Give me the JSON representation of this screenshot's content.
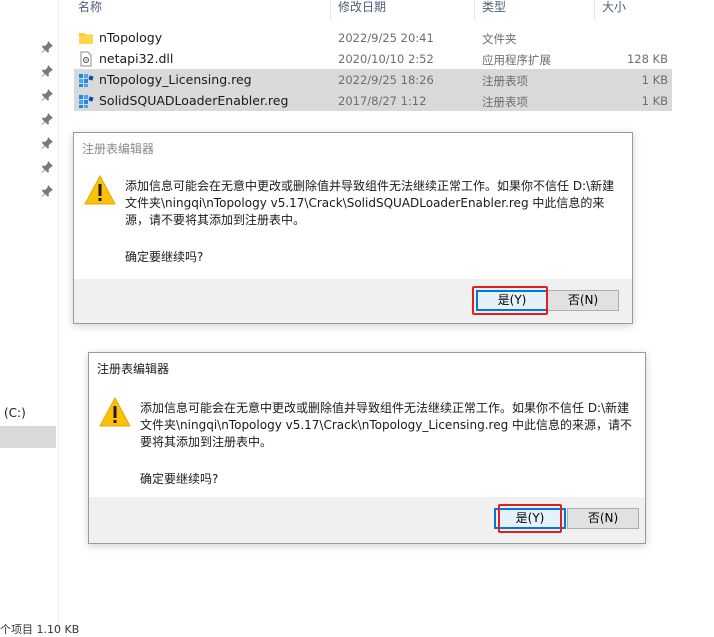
{
  "columns": {
    "name": "名称",
    "date": "修改日期",
    "type": "类型",
    "size": "大小"
  },
  "files": [
    {
      "name": "nTopology",
      "date": "2022/9/25 20:41",
      "type": "文件夹",
      "size": "",
      "icon": "folder-icon",
      "selected": false
    },
    {
      "name": "netapi32.dll",
      "date": "2020/10/10 2:52",
      "type": "应用程序扩展",
      "size": "128 KB",
      "icon": "dll-file-icon",
      "selected": false
    },
    {
      "name": "nTopology_Licensing.reg",
      "date": "2022/9/25 18:26",
      "type": "注册表项",
      "size": "1 KB",
      "icon": "registry-file-icon",
      "selected": true
    },
    {
      "name": "SolidSQUADLoaderEnabler.reg",
      "date": "2017/8/27 1:12",
      "type": "注册表项",
      "size": "1 KB",
      "icon": "registry-file-icon",
      "selected": true
    }
  ],
  "nav": {
    "drive_label": "(C:)",
    "status": "个项目  1.10 KB"
  },
  "dialog1": {
    "title": "注册表编辑器",
    "message": "添加信息可能会在无意中更改或删除值并导致组件无法继续正常工作。如果你不信任 D:\\新建文件夹\\ningqi\\nTopology v5.17\\Crack\\SolidSQUADLoaderEnabler.reg 中此信息的来源，请不要将其添加到注册表中。",
    "confirm": "确定要继续吗?",
    "yes_label": "是(Y)",
    "no_label": "否(N)",
    "icon": "warning-icon"
  },
  "dialog2": {
    "title": "注册表编辑器",
    "message": "添加信息可能会在无意中更改或删除值并导致组件无法继续正常工作。如果你不信任 D:\\新建文件夹\\ningqi\\nTopology v5.17\\Crack\\nTopology_Licensing.reg 中此信息的来源，请不要将其添加到注册表中。",
    "confirm": "确定要继续吗?",
    "yes_label": "是(Y)",
    "no_label": "否(N)",
    "icon": "warning-icon"
  },
  "colors": {
    "accent": "#0078d7",
    "highlight": "#e02020",
    "selection": "#d9d9d9",
    "warning": "#ffc107"
  }
}
